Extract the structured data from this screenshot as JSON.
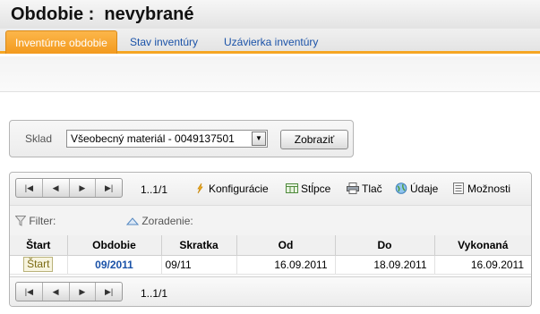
{
  "page": {
    "title": "Obdobie :  nevybrané"
  },
  "tabs": [
    {
      "label": "Inventúrne obdobie",
      "active": true
    },
    {
      "label": "Stav inventúry",
      "active": false
    },
    {
      "label": "Uzávierka inventúry",
      "active": false
    }
  ],
  "filter_form": {
    "sklad_label": "Sklad",
    "sklad_value": "Všeobecný materiál - 0049137501",
    "show_button": "Zobraziť"
  },
  "grid": {
    "page_info": "1..1/1",
    "tools": {
      "config": "Konfigurácie",
      "columns": "Stĺpce",
      "print": "Tlač",
      "data": "Údaje",
      "options": "Možnosti"
    },
    "filter_label": "Filter:",
    "sort_label": "Zoradenie:",
    "columns": [
      "Štart",
      "Obdobie",
      "Skratka",
      "Od",
      "Do",
      "Vykonaná"
    ],
    "rows": [
      {
        "start": "Štart",
        "obdobie": "09/2011",
        "skratka": "09/11",
        "od": "16.09.2011",
        "do": "18.09.2011",
        "vykonana": "16.09.2011"
      }
    ],
    "footer_page_info": "1..1/1"
  },
  "colors": {
    "tab_active": "#f5a623",
    "link": "#1a52a8"
  }
}
